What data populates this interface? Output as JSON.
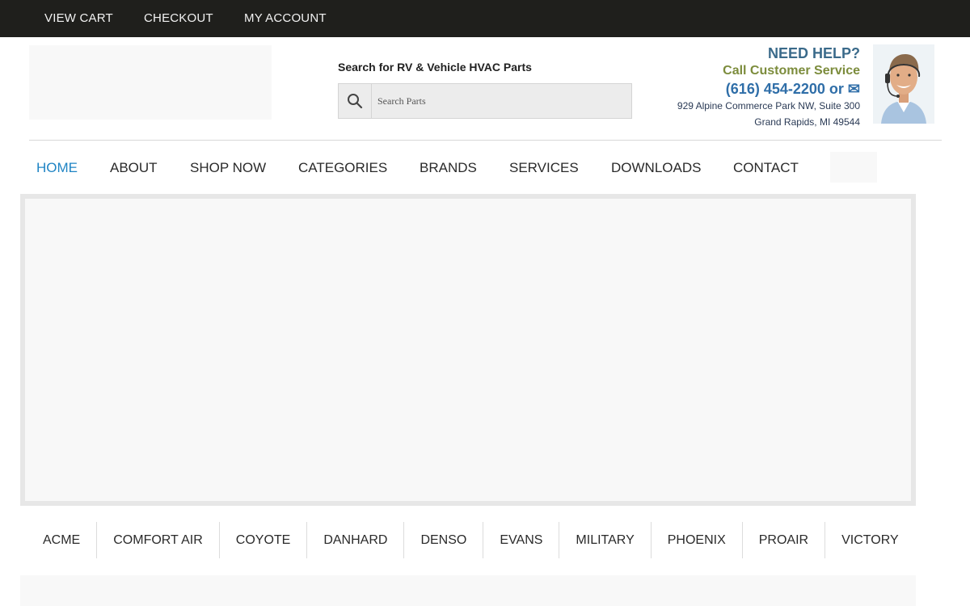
{
  "topbar": {
    "links": [
      "VIEW CART",
      "CHECKOUT",
      "MY ACCOUNT"
    ]
  },
  "search": {
    "title": "Search for RV & Vehicle HVAC Parts",
    "placeholder": "Search Parts"
  },
  "help": {
    "title": "NEED HELP?",
    "subtitle": "Call Customer Service",
    "phone": "(616) 454-2200 or",
    "email_icon": "✉",
    "address_line1": "929 Alpine Commerce Park NW, Suite 300",
    "address_line2": "Grand Rapids, MI 49544"
  },
  "nav": {
    "items": [
      "HOME",
      "ABOUT",
      "SHOP NOW",
      "CATEGORIES",
      "BRANDS",
      "SERVICES",
      "DOWNLOADS",
      "CONTACT"
    ],
    "active": "HOME"
  },
  "brands": [
    "ACME",
    "COMFORT AIR",
    "COYOTE",
    "DANHARD",
    "DENSO",
    "EVANS",
    "MILITARY",
    "PHOENIX",
    "PROAIR",
    "VICTORY"
  ],
  "colors": {
    "topbar_bg": "#1f1f1c",
    "nav_active": "#1f84c4",
    "help_title": "#3a6a8a",
    "help_subtitle": "#7c8c3c",
    "help_phone": "#2f6ea8"
  }
}
